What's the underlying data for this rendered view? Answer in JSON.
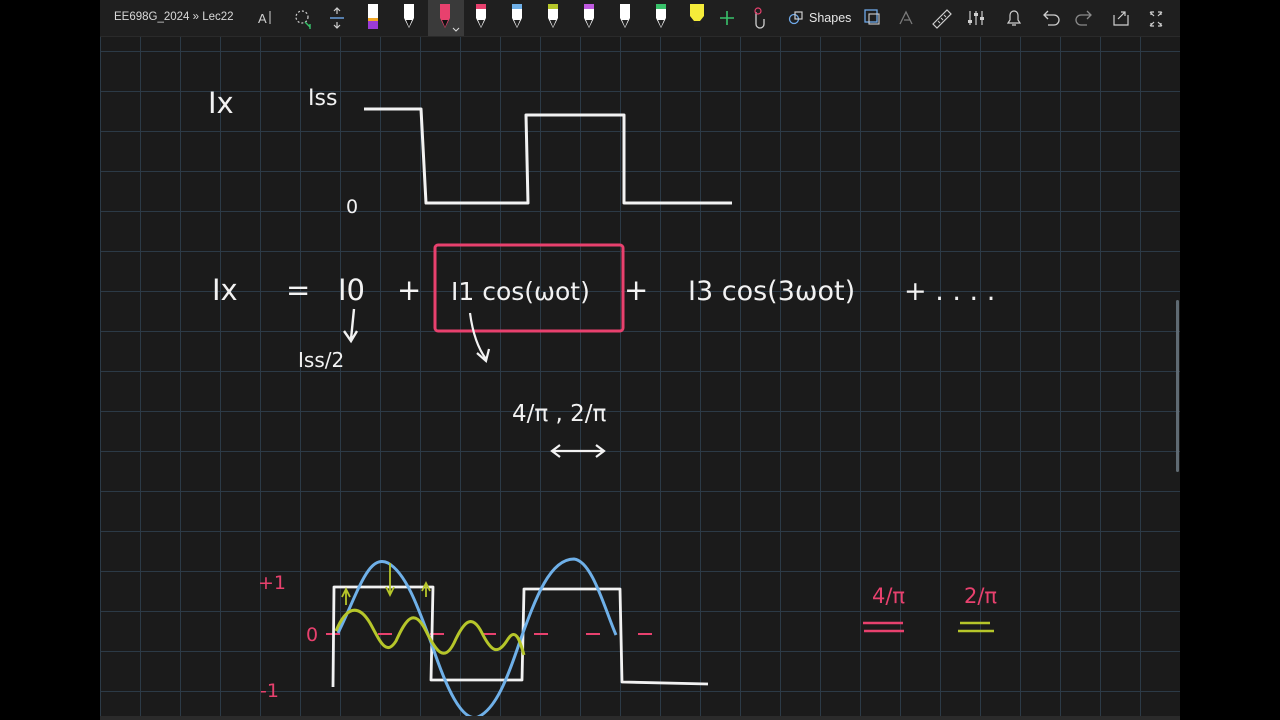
{
  "toolbar": {
    "breadcrumb": "EE698G_2024 » Lec22",
    "shapes_label": "Shapes",
    "icons": [
      "text-select-icon",
      "lasso-icon",
      "space-insert-icon",
      "pen-icon",
      "pen-icon",
      "pen-icon",
      "pen-icon",
      "pen-icon",
      "pen-icon",
      "pen-icon",
      "pen-icon",
      "pen-icon",
      "highlighter-icon",
      "add-pen-icon",
      "touch-write-icon",
      "shapes-icon",
      "ink-to-shape-icon",
      "ink-to-math-icon",
      "ruler-icon",
      "settings-icon",
      "bell-icon",
      "undo-icon",
      "redo-icon",
      "share-icon",
      "fullscreen-icon"
    ]
  },
  "ink": {
    "eq1": {
      "lhs": "Ix",
      "high_label": "Iss",
      "low_label": "0"
    },
    "eq2": {
      "lhs": "Ix",
      "equals": "=",
      "t0": "I0",
      "plus": "+",
      "t1": "I1 cos(ωot)",
      "t3": "I3 cos(3ωot)",
      "tail": "+ . . . .",
      "io_value": "Iss/2",
      "i1_value": "4/π , 2/π"
    },
    "plot": {
      "plus_one": "+1",
      "zero": "0",
      "minus_one": "-1"
    },
    "side": {
      "left": "4/π",
      "right": "2/π"
    }
  },
  "colors": {
    "white": "#f2f2f2",
    "pink": "#e8416e",
    "blue": "#6fb0e8",
    "green": "#b6c62a",
    "grid": "#2c3a46",
    "toolbar": "#1f1f1f"
  }
}
